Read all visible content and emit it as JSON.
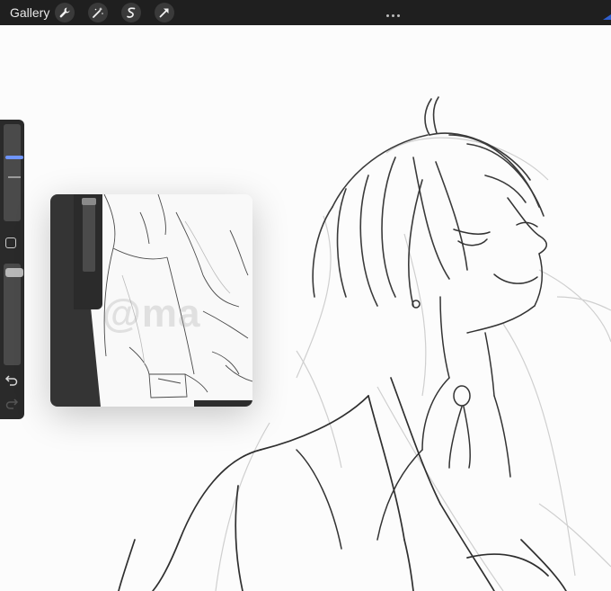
{
  "toolbar": {
    "gallery_label": "Gallery",
    "tools": [
      {
        "name": "wrench-icon"
      },
      {
        "name": "magic-wand-icon"
      },
      {
        "name": "selection-icon"
      },
      {
        "name": "transform-arrow-icon"
      }
    ],
    "more_icon": "more-dots-icon"
  },
  "reference": {
    "watermark": "@ma"
  },
  "colors": {
    "toolbar_bg": "#1f1f1f",
    "accent": "#2f5fd0",
    "sidebar_bg": "#2a2a2a",
    "size_thumb": "#6f95ff"
  }
}
